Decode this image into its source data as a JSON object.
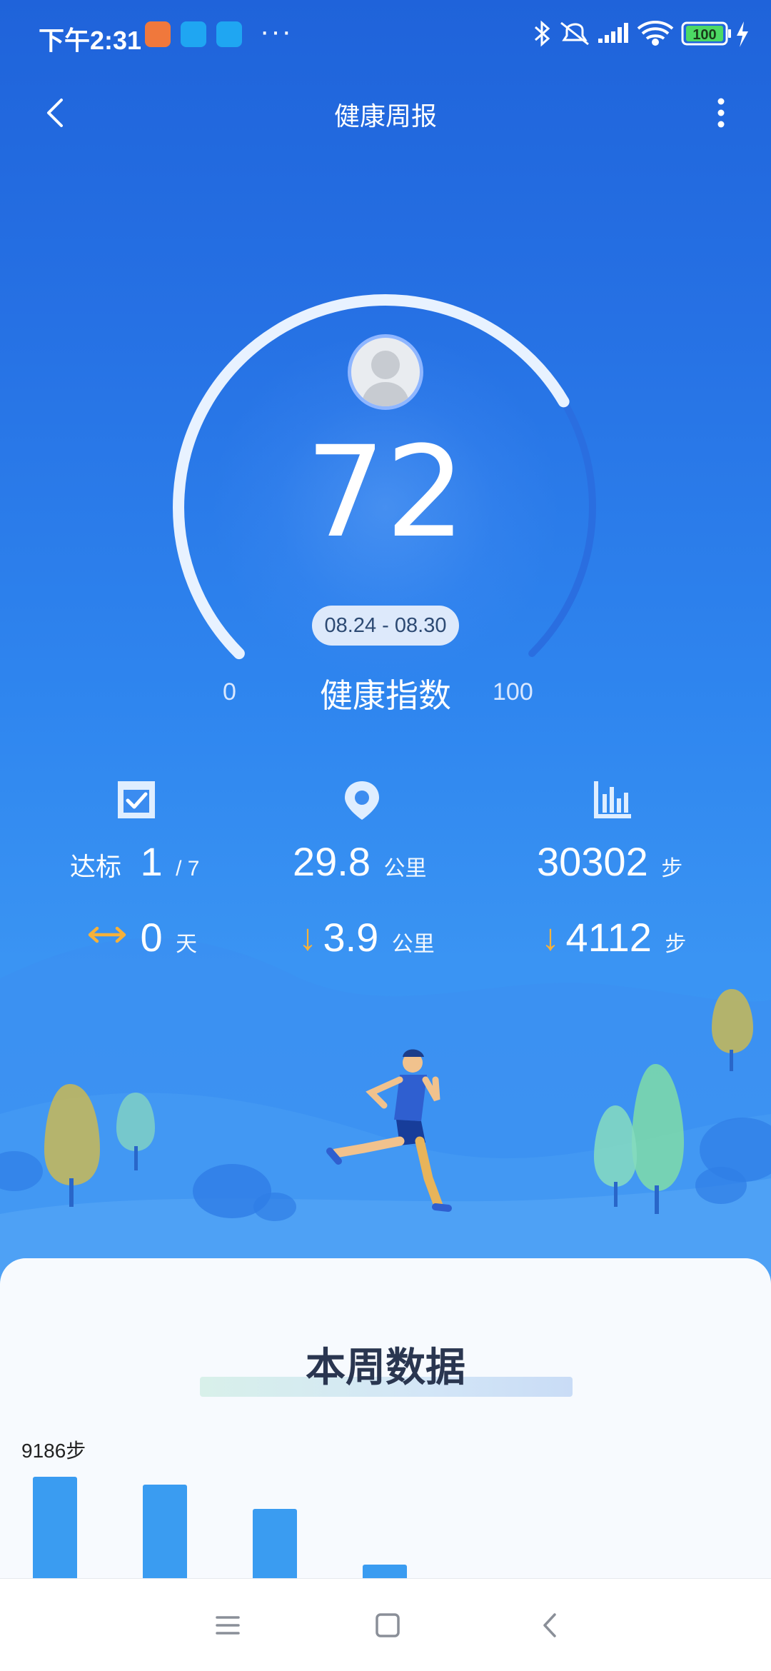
{
  "status_bar": {
    "time": "下午2:31",
    "dots": "···",
    "battery": "100",
    "icons": [
      "bluetooth-icon",
      "mute-icon",
      "signal-icon",
      "wifi-icon",
      "battery-icon",
      "charging-icon"
    ]
  },
  "header": {
    "title": "健康周报"
  },
  "gauge": {
    "score": "72",
    "score_fraction": 0.72,
    "date_range": "08.24 - 08.30",
    "label": "健康指数",
    "min": "0",
    "max": "100"
  },
  "stats": {
    "goal": {
      "label": "达标",
      "value": "1",
      "total": "/ 7"
    },
    "distance": {
      "value": "29.8",
      "unit": "公里"
    },
    "steps": {
      "value": "30302",
      "unit": "步"
    },
    "streak": {
      "value": "0",
      "unit": "天"
    },
    "distance_change": {
      "value": "3.9",
      "unit": "公里",
      "direction": "down"
    },
    "steps_change": {
      "value": "4112",
      "unit": "步",
      "direction": "down"
    }
  },
  "weekly": {
    "title": "本周数据",
    "top_value_label": "9186步",
    "bars": [
      9186,
      8500,
      6300,
      1200
    ]
  },
  "colors": {
    "primary": "#2a7be6",
    "accent_orange": "#f6b13a",
    "bar": "#3a9cf1"
  }
}
